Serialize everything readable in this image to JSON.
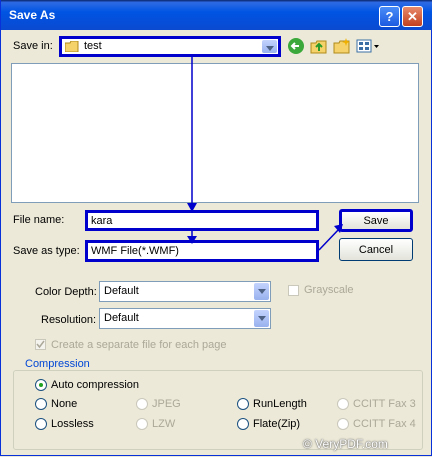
{
  "window": {
    "title": "Save As"
  },
  "titlebar": {
    "help_label": "?",
    "close_label": "✕"
  },
  "save_in": {
    "label": "Save in:",
    "value": "test"
  },
  "toolbar": {
    "icons": [
      "back-icon",
      "up-folder-icon",
      "new-folder-icon",
      "views-menu-icon"
    ]
  },
  "file_name": {
    "label": "File name:",
    "value": "kara"
  },
  "save_as_type": {
    "label": "Save as type:",
    "value": "WMF File(*.WMF)"
  },
  "buttons": {
    "save": "Save",
    "cancel": "Cancel"
  },
  "options": {
    "color_depth": {
      "label": "Color Depth:",
      "value": "Default"
    },
    "resolution": {
      "label": "Resolution:",
      "value": "Default"
    },
    "grayscale": "Grayscale",
    "separate_file": "Create a separate file for each page"
  },
  "compression": {
    "label": "Compression",
    "auto": "Auto compression",
    "none": "None",
    "jpeg": "JPEG",
    "runlength": "RunLength",
    "ccitt3": "CCITT Fax 3",
    "lossless": "Lossless",
    "lzw": "LZW",
    "flate": "Flate(Zip)",
    "ccitt4": "CCITT Fax 4"
  },
  "watermark": "© VeryPDF.com",
  "colors": {
    "highlight": "#0000cc",
    "title_bar": "#0054e3",
    "face": "#ece9d8"
  }
}
